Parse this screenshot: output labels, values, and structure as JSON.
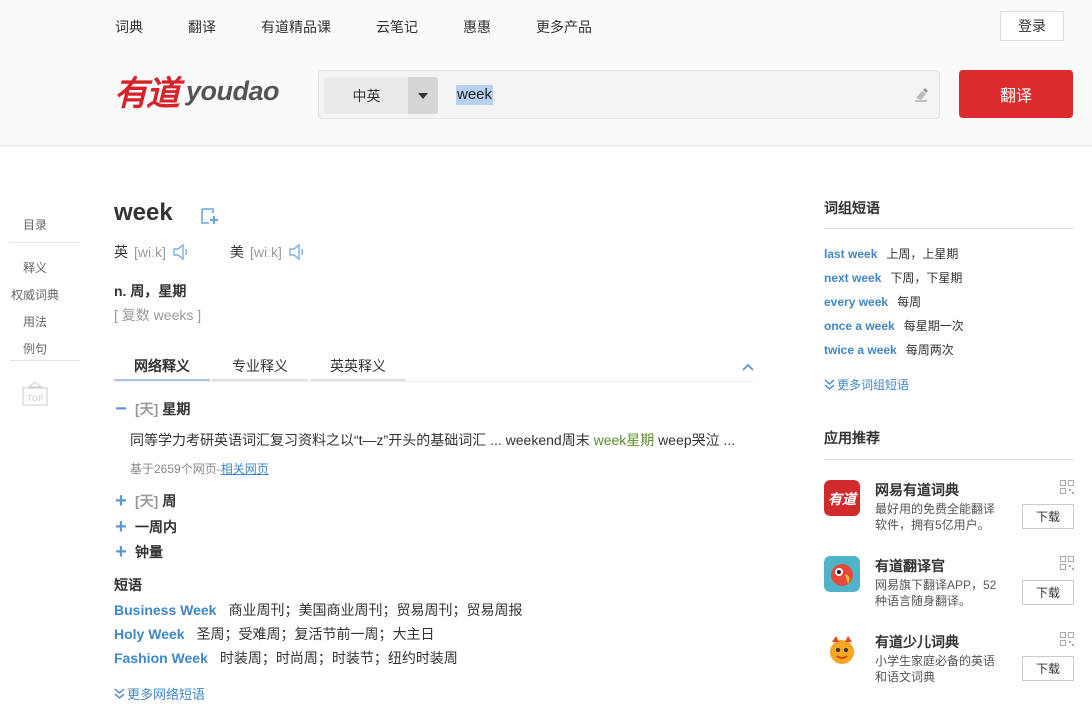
{
  "topnav": [
    "词典",
    "翻译",
    "有道精品课",
    "云笔记",
    "惠惠",
    "更多产品"
  ],
  "login_label": "登录",
  "logo": {
    "cn": "有道",
    "en": "youdao"
  },
  "search": {
    "lang": "中英",
    "query": "week",
    "button": "翻译"
  },
  "sidenav": [
    "目录",
    "释义",
    "权威词典",
    "用法",
    "例句"
  ],
  "word": {
    "headword": "week",
    "pron_uk_label": "英",
    "pron_uk": "[wiːk]",
    "pron_us_label": "美",
    "pron_us": "[wiːk]",
    "definition": "n. 周，星期",
    "plural": "[ 复数 weeks ]"
  },
  "tabs": [
    "网络释义",
    "专业释义",
    "英英释义"
  ],
  "senses": [
    {
      "sign": "−",
      "tag": "[天]",
      "term": "星期"
    },
    {
      "sign": "+",
      "tag": "[天]",
      "term": "周"
    },
    {
      "sign": "+",
      "tag": "",
      "term": "一周内"
    },
    {
      "sign": "+",
      "tag": "",
      "term": "钟量"
    }
  ],
  "example": {
    "before": "同等学力考研英语词汇复习资料之以“t—z”开头的基础词汇 ... weekend周末 ",
    "highlight": "week星期",
    "after": " weep哭泣 ..."
  },
  "source": {
    "prefix": "基于2659个网页-",
    "link": "相关网页"
  },
  "phrases": {
    "title": "短语",
    "items": [
      {
        "en": "Business Week",
        "cn": "商业周刊；美国商业周刊；贸易周刊；贸易周报"
      },
      {
        "en": "Holy Week",
        "cn": "圣周；受难周；复活节前一周；大主日"
      },
      {
        "en": "Fashion Week",
        "cn": "时装周；时尚周；时装节；纽约时装周"
      }
    ],
    "more": "更多网络短语"
  },
  "right_phrases": {
    "title": "词组短语",
    "items": [
      {
        "en": "last week",
        "cn": "上周，上星期"
      },
      {
        "en": "next week",
        "cn": "下周，下星期"
      },
      {
        "en": "every week",
        "cn": "每周"
      },
      {
        "en": "once a week",
        "cn": "每星期一次"
      },
      {
        "en": "twice a week",
        "cn": "每周两次"
      }
    ],
    "more": "更多词组短语"
  },
  "apps": {
    "title": "应用推荐",
    "download": "下载",
    "items": [
      {
        "name": "网易有道词典",
        "desc": "最好用的免费全能翻译软件，拥有5亿用户。"
      },
      {
        "name": "有道翻译官",
        "desc": "网易旗下翻译APP，52种语言随身翻译。"
      },
      {
        "name": "有道少儿词典",
        "desc": "小学生家庭必备的英语和语文词典"
      }
    ]
  },
  "colors": {
    "brand_red": "#dd2c2e",
    "link_blue": "#3f87c8",
    "highlight_green": "#5a8d2a"
  }
}
